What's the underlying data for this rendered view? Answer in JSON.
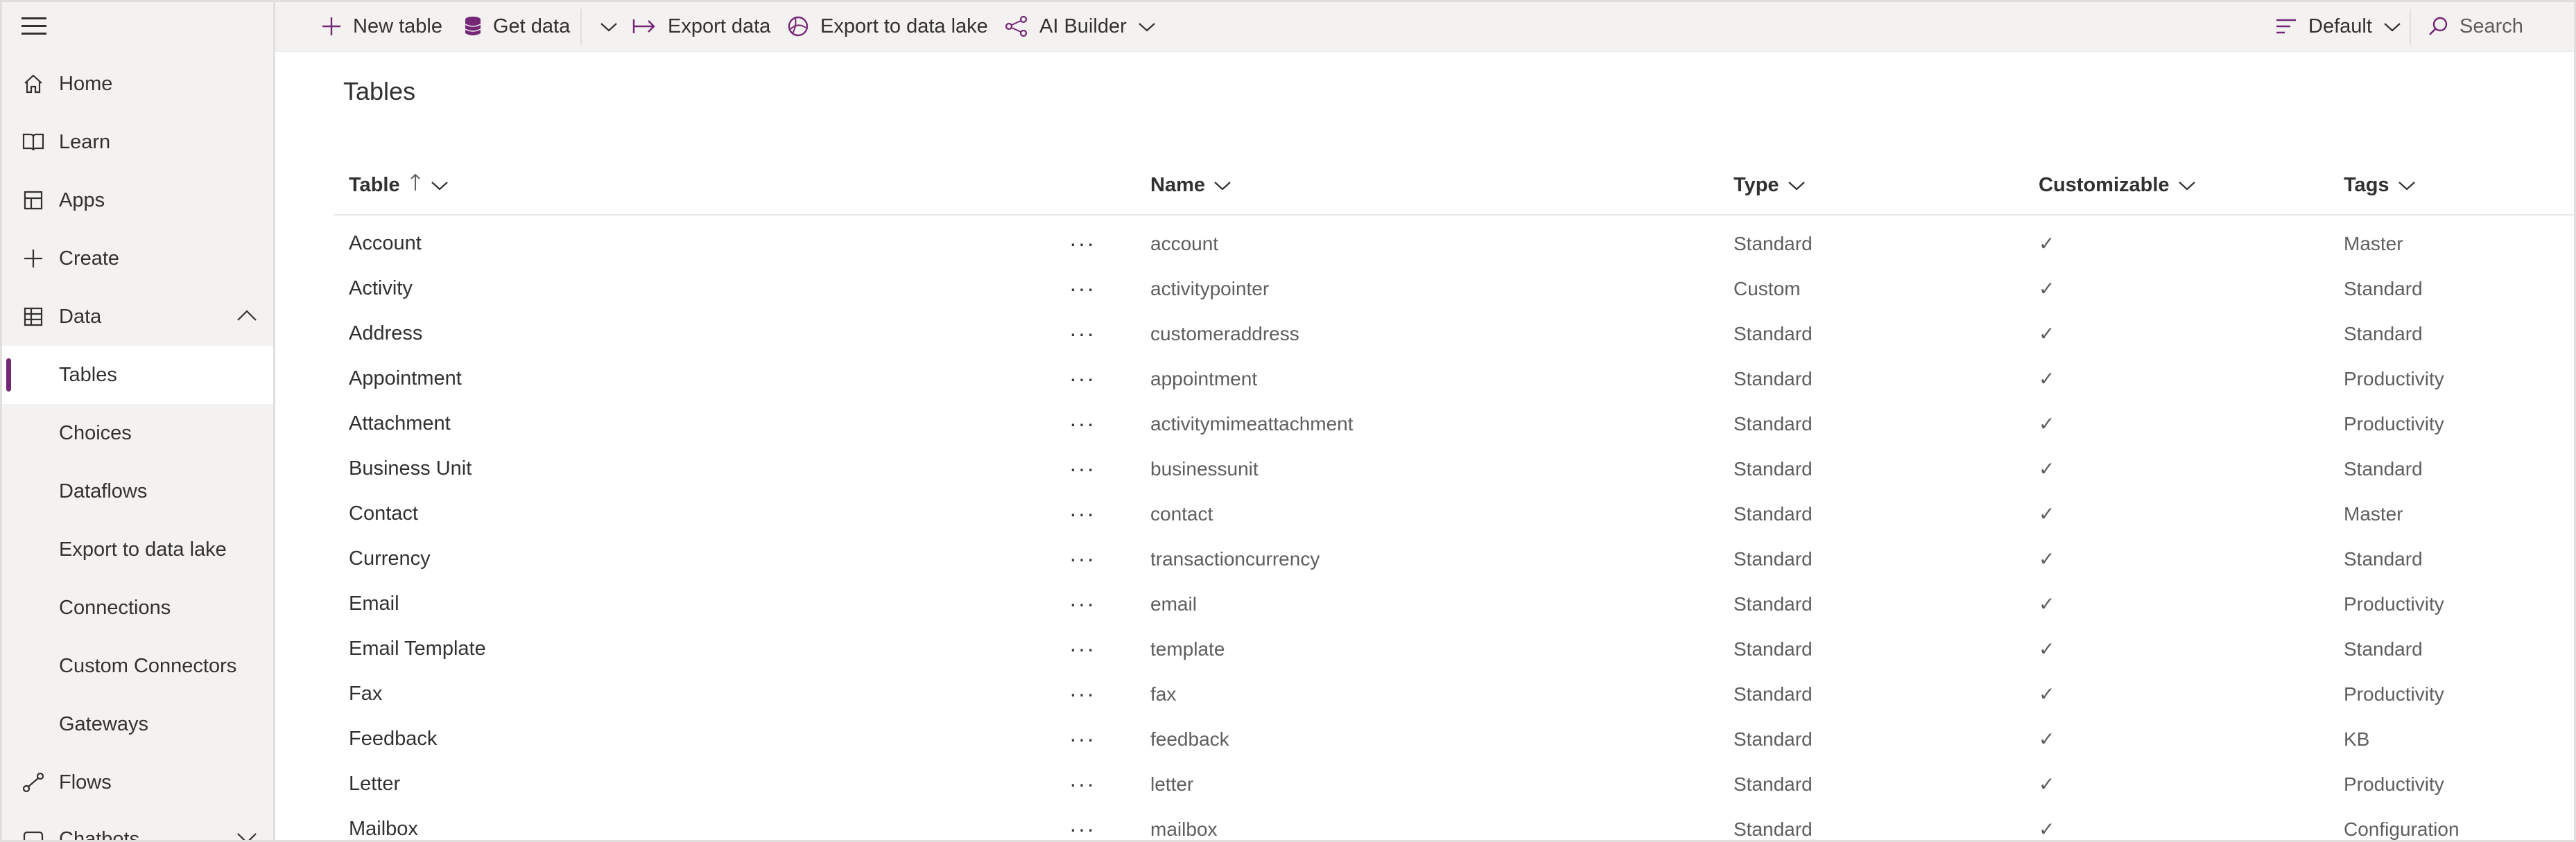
{
  "sidebar": {
    "items": [
      {
        "label": "Home",
        "icon": "home-icon"
      },
      {
        "label": "Learn",
        "icon": "book-icon"
      },
      {
        "label": "Apps",
        "icon": "apps-icon"
      },
      {
        "label": "Create",
        "icon": "plus-icon"
      },
      {
        "label": "Data",
        "icon": "table-icon"
      }
    ],
    "sub_items": [
      {
        "label": "Tables",
        "active": true
      },
      {
        "label": "Choices"
      },
      {
        "label": "Dataflows"
      },
      {
        "label": "Export to data lake"
      },
      {
        "label": "Connections"
      },
      {
        "label": "Custom Connectors"
      },
      {
        "label": "Gateways"
      }
    ],
    "bottom_items": [
      {
        "label": "Flows",
        "icon": "flow-icon"
      },
      {
        "label": "Chatbots",
        "icon": "chatbot-icon"
      }
    ]
  },
  "toolbar": {
    "new_table": "New table",
    "get_data": "Get data",
    "export_data": "Export data",
    "export_lake": "Export to data lake",
    "ai_builder": "AI Builder",
    "view": "Default",
    "search": "Search"
  },
  "page": {
    "title": "Tables"
  },
  "table": {
    "columns": [
      "Table",
      "Name",
      "Type",
      "Customizable",
      "Tags"
    ],
    "rows": [
      {
        "table": "Account",
        "name": "account",
        "type": "Standard",
        "customizable": "✓",
        "tags": "Master"
      },
      {
        "table": "Activity",
        "name": "activitypointer",
        "type": "Custom",
        "customizable": "✓",
        "tags": "Standard"
      },
      {
        "table": "Address",
        "name": "customeraddress",
        "type": "Standard",
        "customizable": "✓",
        "tags": "Standard"
      },
      {
        "table": "Appointment",
        "name": "appointment",
        "type": "Standard",
        "customizable": "✓",
        "tags": "Productivity"
      },
      {
        "table": "Attachment",
        "name": "activitymimeattachment",
        "type": "Standard",
        "customizable": "✓",
        "tags": "Productivity"
      },
      {
        "table": "Business Unit",
        "name": "businessunit",
        "type": "Standard",
        "customizable": "✓",
        "tags": "Standard"
      },
      {
        "table": "Contact",
        "name": "contact",
        "type": "Standard",
        "customizable": "✓",
        "tags": "Master"
      },
      {
        "table": "Currency",
        "name": "transactioncurrency",
        "type": "Standard",
        "customizable": "✓",
        "tags": "Standard"
      },
      {
        "table": "Email",
        "name": "email",
        "type": "Standard",
        "customizable": "✓",
        "tags": "Productivity"
      },
      {
        "table": "Email Template",
        "name": "template",
        "type": "Standard",
        "customizable": "✓",
        "tags": "Standard"
      },
      {
        "table": "Fax",
        "name": "fax",
        "type": "Standard",
        "customizable": "✓",
        "tags": "Productivity"
      },
      {
        "table": "Feedback",
        "name": "feedback",
        "type": "Standard",
        "customizable": "✓",
        "tags": "KB"
      },
      {
        "table": "Letter",
        "name": "letter",
        "type": "Standard",
        "customizable": "✓",
        "tags": "Productivity"
      },
      {
        "table": "Mailbox",
        "name": "mailbox",
        "type": "Standard",
        "customizable": "✓",
        "tags": "Configuration"
      }
    ]
  },
  "colors": {
    "accent": "#742774",
    "sidebar_bg": "#f3f2f1"
  }
}
